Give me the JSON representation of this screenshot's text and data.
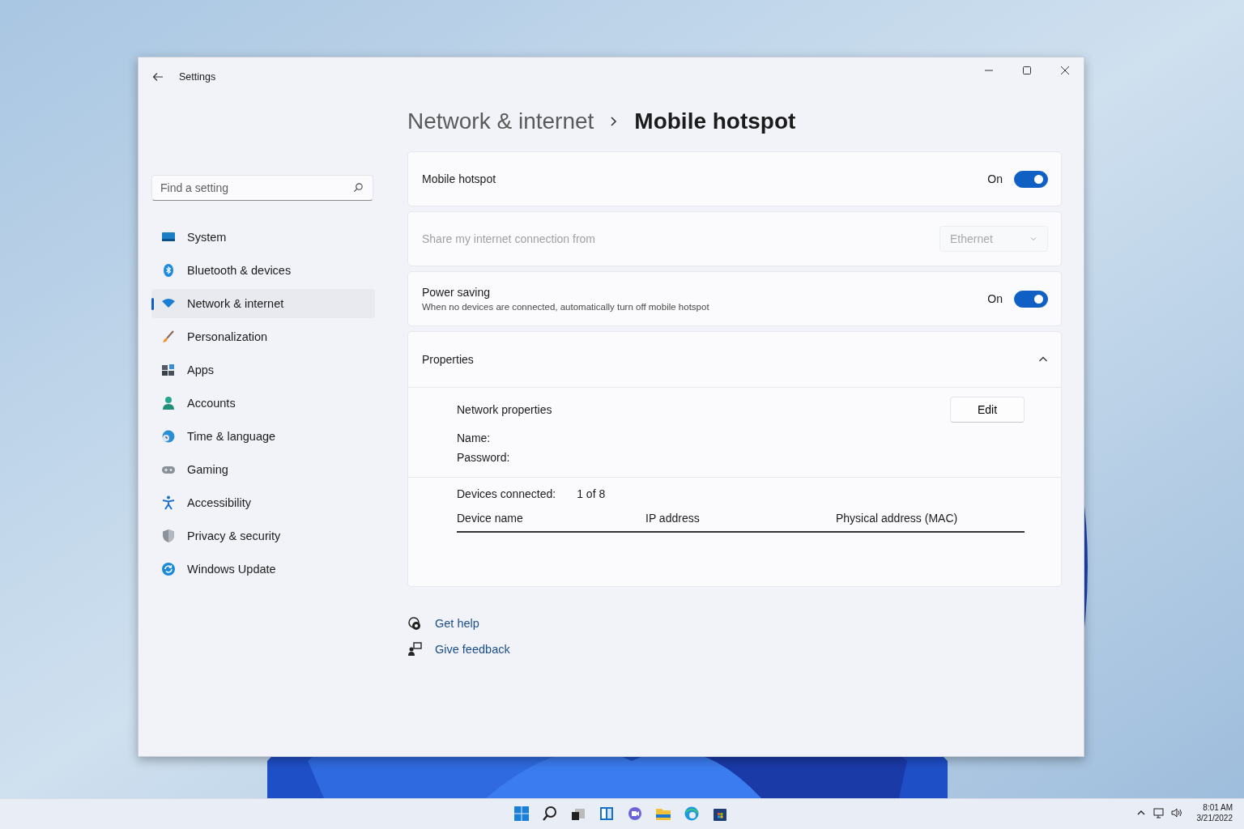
{
  "window": {
    "title": "Settings"
  },
  "search": {
    "placeholder": "Find a setting"
  },
  "sidebar": {
    "items": [
      {
        "label": "System",
        "selected": false
      },
      {
        "label": "Bluetooth & devices",
        "selected": false
      },
      {
        "label": "Network & internet",
        "selected": true
      },
      {
        "label": "Personalization",
        "selected": false
      },
      {
        "label": "Apps",
        "selected": false
      },
      {
        "label": "Accounts",
        "selected": false
      },
      {
        "label": "Time & language",
        "selected": false
      },
      {
        "label": "Gaming",
        "selected": false
      },
      {
        "label": "Accessibility",
        "selected": false
      },
      {
        "label": "Privacy & security",
        "selected": false
      },
      {
        "label": "Windows Update",
        "selected": false
      }
    ]
  },
  "breadcrumb": {
    "parent": "Network & internet",
    "current": "Mobile hotspot"
  },
  "cards": [
    {
      "kind": "toggle",
      "label": "Mobile hotspot",
      "state_text": "On",
      "on": true
    },
    {
      "kind": "dropdown",
      "label": "Share my internet connection from",
      "value": "Ethernet",
      "disabled": true
    },
    {
      "kind": "toggle",
      "label": "Power saving",
      "description": "When no devices are connected, automatically turn off mobile hotspot",
      "state_text": "On",
      "on": true
    }
  ],
  "properties": {
    "title": "Properties",
    "expanded": true,
    "network_label": "Network properties",
    "edit_button": "Edit",
    "fields": [
      "Name:",
      "Password:"
    ],
    "devices_label": "Devices connected:",
    "devices_value": "1 of 8",
    "columns": [
      "Device name",
      "IP address",
      "Physical address (MAC)"
    ]
  },
  "links": [
    "Get help",
    "Give feedback"
  ],
  "taskbar": {
    "time": "8:01 AM",
    "date": "3/21/2022"
  }
}
